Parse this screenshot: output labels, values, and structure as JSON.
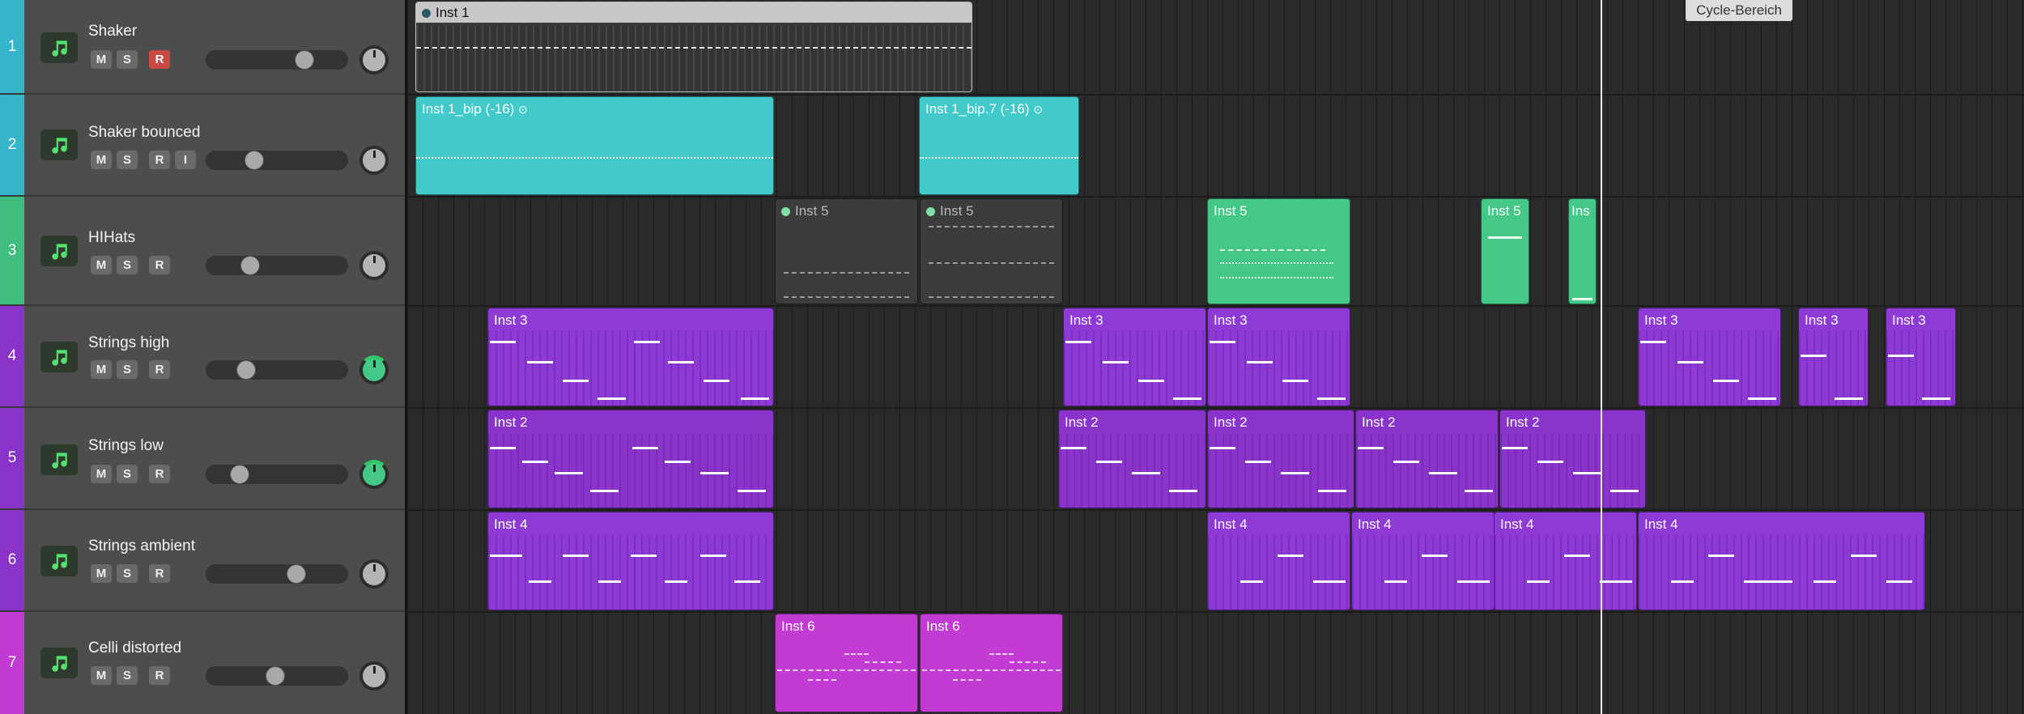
{
  "tracks": [
    {
      "num": "1",
      "name": "Shaker",
      "buttons": [
        "M",
        "S",
        "R"
      ],
      "color": "#36b4c9"
    },
    {
      "num": "2",
      "name": "Shaker bounced",
      "buttons": [
        "M",
        "S",
        "R",
        "I"
      ],
      "color": "#36b4c9"
    },
    {
      "num": "3",
      "name": "HIHats",
      "buttons": [
        "M",
        "S",
        "R"
      ],
      "color": "#3fbd7e"
    },
    {
      "num": "4",
      "name": "Strings high",
      "buttons": [
        "M",
        "S",
        "R"
      ],
      "color": "#8a33c9"
    },
    {
      "num": "5",
      "name": "Strings low",
      "buttons": [
        "M",
        "S",
        "R"
      ],
      "color": "#8a33c9"
    },
    {
      "num": "6",
      "name": "Strings ambient",
      "buttons": [
        "M",
        "S",
        "R"
      ],
      "color": "#8a33c9"
    },
    {
      "num": "7",
      "name": "Celli distorted",
      "buttons": [
        "M",
        "S",
        "R"
      ],
      "color": "#c23bd2"
    }
  ],
  "regions": {
    "r1": "Inst 1",
    "r2a": "Inst 1_bip (-16)",
    "r2b": "Inst 1_bip.7 (-16)",
    "r3a": "Inst 5",
    "r3b": "Inst 5",
    "r3c": "Inst 5",
    "r3d": "Inst 5",
    "r3e": "Ins",
    "r4a": "Inst 3",
    "r4b": "Inst 3",
    "r4c": "Inst 3",
    "r4d": "Inst 3",
    "r4e": "Inst 3",
    "r4f": "Inst 3",
    "r5a": "Inst 2",
    "r5b": "Inst 2",
    "r5c": "Inst 2",
    "r5d": "Inst 2",
    "r5e": "Inst 2",
    "r6a": "Inst 4",
    "r6b": "Inst 4",
    "r6c": "Inst 4",
    "r6d": "Inst 4",
    "r6e": "Inst 4",
    "r7a": "Inst 6",
    "r7b": "Inst 6"
  },
  "cycle_label": "Cycle-Bereich",
  "colors": {
    "cyan": "#42c9c9",
    "purple": "#8e3ad4",
    "green": "#45c887",
    "magenta": "#c23bd2",
    "record": "#c94a43"
  },
  "icons": {
    "instrument": "music-note-icon"
  }
}
